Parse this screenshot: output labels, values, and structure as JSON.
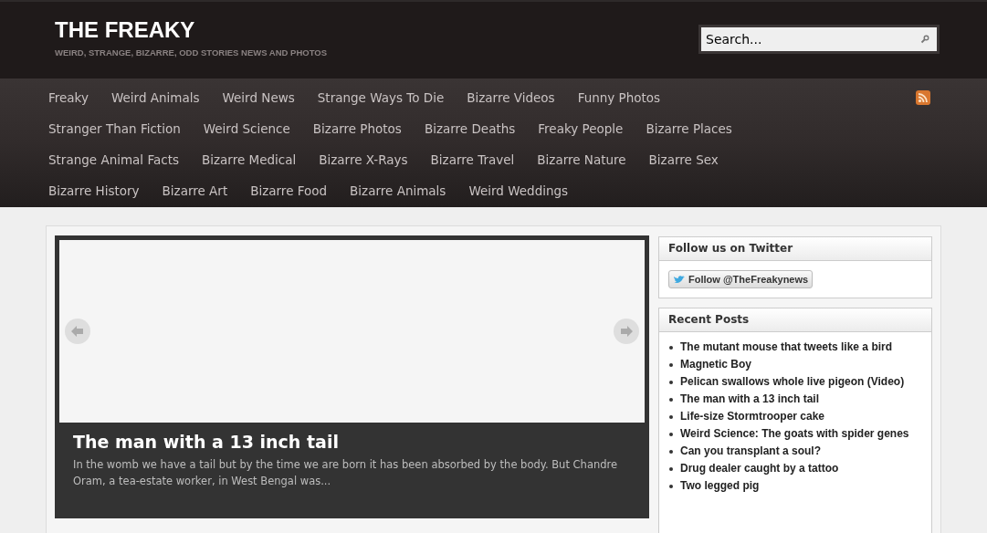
{
  "site": {
    "title": "THE FREAKY",
    "tagline": "WEIRD, STRANGE, BIZARRE, ODD STORIES NEWS AND PHOTOS"
  },
  "search": {
    "placeholder": "Search..."
  },
  "nav": {
    "rows": [
      [
        "Freaky",
        "Weird Animals",
        "Weird News",
        "Strange Ways To Die",
        "Bizarre Videos",
        "Funny Photos"
      ],
      [
        "Stranger Than Fiction",
        "Weird Science",
        "Bizarre Photos",
        "Bizarre Deaths",
        "Freaky People",
        "Bizarre Places"
      ],
      [
        "Strange Animal Facts",
        "Bizarre Medical",
        "Bizarre X-Rays",
        "Bizarre Travel",
        "Bizarre Nature",
        "Bizarre Sex"
      ],
      [
        "Bizarre History",
        "Bizarre Art",
        "Bizarre Food",
        "Bizarre Animals",
        "Weird Weddings"
      ]
    ]
  },
  "slider": {
    "title": "The man with a 13 inch tail",
    "excerpt": "In the womb we have a tail but by the time we are born it has been absorbed by the body. But Chandre Oram, a tea-estate worker, in West Bengal was..."
  },
  "sidebar": {
    "twitter": {
      "heading": "Follow us on Twitter",
      "button": "Follow @TheFreakynews"
    },
    "recent_posts": {
      "heading": "Recent Posts",
      "items": [
        "The mutant mouse that tweets like a bird",
        "Magnetic Boy",
        "Pelican swallows whole live pigeon (Video)",
        "The man with a 13 inch tail",
        "Life-size Stormtrooper cake",
        "Weird Science: The goats with spider genes",
        "Can you transplant a soul?",
        "Drug dealer caught by a tattoo",
        "Two legged pig"
      ]
    }
  }
}
